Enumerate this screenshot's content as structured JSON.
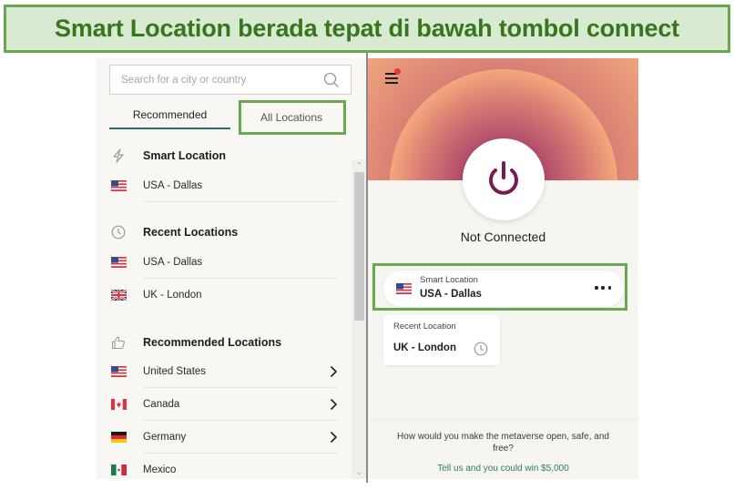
{
  "banner": {
    "text": "Smart Location berada tepat di bawah tombol connect",
    "fill_color": "#d9ead3",
    "border_color": "#6aa84f",
    "text_color": "#38761d"
  },
  "left_panel": {
    "search": {
      "placeholder": "Search for a city or country",
      "value": "",
      "icon": "search-icon"
    },
    "tabs": [
      {
        "label": "Recommended",
        "active": true
      },
      {
        "label": "All Locations",
        "active": false,
        "highlighted": true
      }
    ],
    "sections": [
      {
        "title": "Smart Location",
        "icon": "lightning-icon",
        "items": [
          {
            "flag": "us",
            "label": "USA - Dallas",
            "chevron": false
          }
        ]
      },
      {
        "title": "Recent Locations",
        "icon": "clock-icon",
        "items": [
          {
            "flag": "us",
            "label": "USA - Dallas",
            "chevron": false
          },
          {
            "flag": "uk",
            "label": "UK - London",
            "chevron": false
          }
        ]
      },
      {
        "title": "Recommended Locations",
        "icon": "thumbs-up-icon",
        "items": [
          {
            "flag": "us",
            "label": "United States",
            "chevron": true
          },
          {
            "flag": "ca",
            "label": "Canada",
            "chevron": true
          },
          {
            "flag": "de",
            "label": "Germany",
            "chevron": true
          },
          {
            "flag": "mx",
            "label": "Mexico",
            "chevron": false
          }
        ]
      }
    ]
  },
  "right_panel": {
    "menu_icon": "hamburger-menu-icon",
    "notification_dot_color": "#e8343c",
    "power_icon": "power-icon",
    "power_color": "#7a1a55",
    "status": "Not Connected",
    "current_location": {
      "subtitle": "Smart Location",
      "name": "USA - Dallas",
      "flag": "us",
      "highlighted": true
    },
    "recent_location": {
      "subtitle": "Recent Location",
      "name": "UK - London"
    },
    "promo": {
      "question": "How would you make the metaverse open, safe, and free?",
      "link": "Tell us and you could win $5,000"
    }
  }
}
